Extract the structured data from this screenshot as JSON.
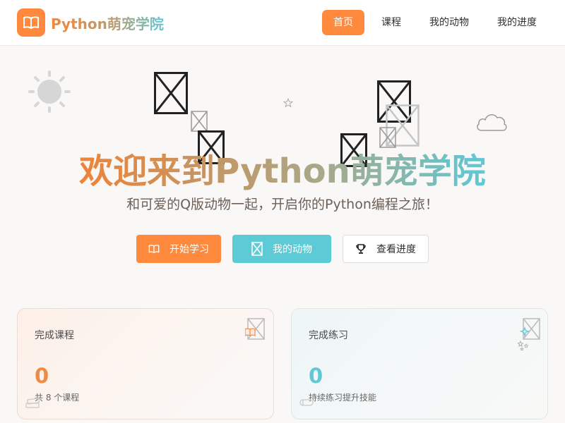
{
  "app": {
    "title": "Python萌宠学院"
  },
  "nav": {
    "items": [
      {
        "label": "首页",
        "active": true
      },
      {
        "label": "课程",
        "active": false
      },
      {
        "label": "我的动物",
        "active": false
      },
      {
        "label": "我的进度",
        "active": false
      }
    ]
  },
  "hero": {
    "title": "欢迎来到Python萌宠学院",
    "subtitle": "和可爱的Q版动物一起，开启你的Python编程之旅！",
    "buttons": {
      "start": "开始学习",
      "pets": "我的动物",
      "progress": "查看进度"
    }
  },
  "stats": {
    "courses": {
      "title": "完成课程",
      "value": "0",
      "desc": "共 8 个课程"
    },
    "exercises": {
      "title": "完成练习",
      "value": "0",
      "desc": "持续练习提升技能"
    }
  },
  "colors": {
    "accent": "#ff8a3d",
    "secondary": "#5dcbd6",
    "background": "#faf8f6"
  },
  "icons": {
    "logo": "book-icon",
    "start": "book-icon",
    "pets": "broken-image-icon",
    "progress": "trophy-icon"
  }
}
